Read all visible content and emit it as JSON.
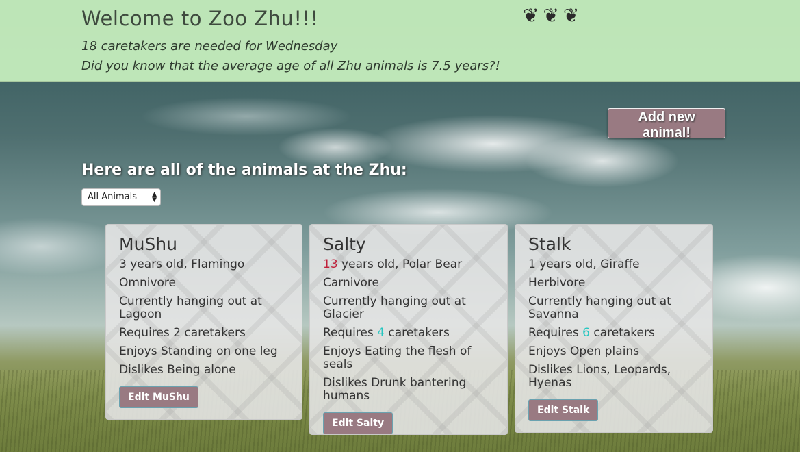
{
  "header": {
    "title": "Welcome to Zoo Zhu!!!",
    "caretakers_line": "18 caretakers are needed for Wednesday",
    "fact_line": "Did you know that the average age of all Zhu animals is 7.5 years?!",
    "decoration": "❦❦❦"
  },
  "actions": {
    "add_label": "Add new animal!"
  },
  "list": {
    "heading": "Here are all of the animals at the Zhu:",
    "filter_value": "All Animals"
  },
  "animals": [
    {
      "name": "MuShu",
      "age": "3",
      "age_suffix": " years old, Flamingo",
      "diet": "Omnivore",
      "location": "Currently hanging out at Lagoon",
      "req_prefix": "Requires ",
      "caretakers": "2",
      "req_suffix": " caretakers",
      "likes": "Enjoys Standing on one leg",
      "dislikes": "Dislikes Being alone",
      "edit_label": "Edit MuShu"
    },
    {
      "name": "Salty",
      "age": "13",
      "age_suffix": " years old, Polar Bear",
      "diet": "Carnivore",
      "location": "Currently hanging out at Glacier",
      "req_prefix": "Requires ",
      "caretakers": "4",
      "req_suffix": " caretakers",
      "likes": "Enjoys Eating the flesh of seals",
      "dislikes": "Dislikes Drunk bantering humans",
      "edit_label": "Edit Salty"
    },
    {
      "name": "Stalk",
      "age": "1",
      "age_suffix": " years old, Giraffe",
      "diet": "Herbivore",
      "location": "Currently hanging out at Savanna",
      "req_prefix": "Requires ",
      "caretakers": "6",
      "req_suffix": " caretakers",
      "likes": "Enjoys Open plains",
      "dislikes": "Dislikes Lions, Leopards, Hyenas",
      "edit_label": "Edit Stalk"
    }
  ],
  "colors": {
    "header_bg": "#c8f0be",
    "button_bg": "#997a82",
    "accent_red": "#c0203a",
    "accent_cyan": "#25c6c0"
  }
}
